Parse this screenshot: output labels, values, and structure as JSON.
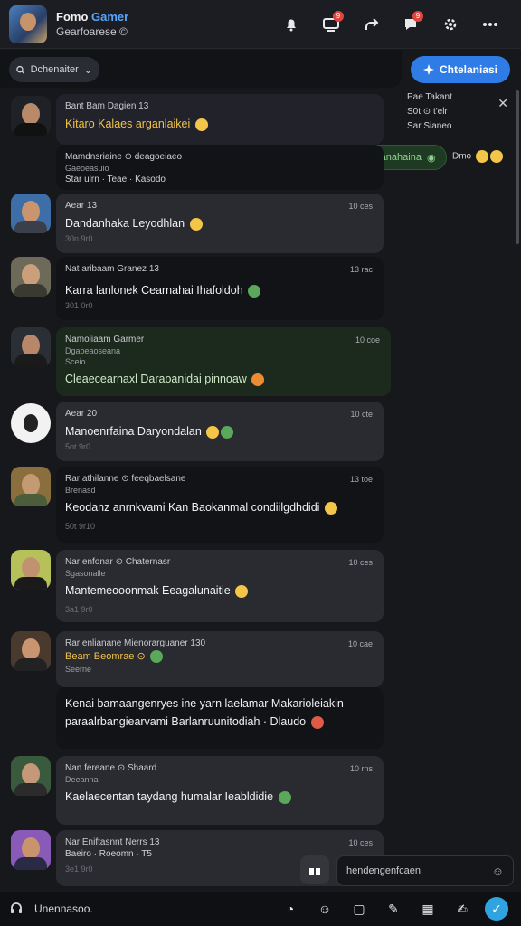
{
  "header": {
    "title_main": "Fomo",
    "title_accent": "Gamer",
    "subtitle": "Gearfoarese ©",
    "badges": [
      "9",
      "9"
    ]
  },
  "filter": {
    "label": "Dchenaiter",
    "chevron": "⌄"
  },
  "cta": {
    "label": "Chtelaniasi"
  },
  "sidepanel": {
    "line1": "Pae Takant",
    "line2": "S0t ⊙ t'elr",
    "line3": "Sar Sianeo"
  },
  "chips": {
    "green": "Abar Danahaina",
    "second": "Dmo"
  },
  "messages": [
    {
      "name": "Bant Bam Dagien 13",
      "sub": "",
      "text": "Kitaro Kalaes arganlaikei",
      "text2_line1": "Mamdnsriaine ⊙ deagoeiaeo",
      "text2_line2": "Gaeoeasuio",
      "text2_line3": "Star ulrn  ·  Teae  ·  Kasodo",
      "time": "",
      "meta": ""
    },
    {
      "name": "Aear 13",
      "sub": "",
      "text": "Dandanhaka Leyodhlan",
      "time": "10 ces",
      "meta": "30n 9r0"
    },
    {
      "name": "Nat aribaam Granez 13",
      "sub": "",
      "text": "Karra lanlonek Cearnahai Ihafoldoh",
      "time": "13 rac",
      "meta": "301 0r0"
    },
    {
      "name": "Namoliaam Garmer",
      "sub": "Dgaoeaoseana",
      "sub2": "Sceio",
      "text": "Cleaecearnaxl Daraoanidai  pinnoaw",
      "time": "10 coe",
      "meta": ""
    },
    {
      "name": "Aear 20",
      "sub": "",
      "text": "Manoenrfaina Daryondalan",
      "time": "10 cte",
      "meta": "5ot 9r0"
    },
    {
      "name": "Rar athilanne ⊙ feeqbaelsane",
      "sub": "Brenasd",
      "text": "Keodanz anrnkvami Kan Baokanmal condiilgdhdidi",
      "time": "13 toe",
      "meta": "50t 9r10"
    },
    {
      "name": "Nar enfonar ⊙ Chaternasr",
      "sub": "Sgasonalle",
      "text": "Mantemeooonmak Eeagalunaitie",
      "time": "10 ces",
      "meta": "3a1 9r0"
    },
    {
      "name": "Rar enlianane Mienorarguaner 130",
      "sub": "Beam Beomrae ⊙",
      "sub2": "Seerne",
      "text": "Kenai bamaangenryes ine yarn laelamar Makarioleiakin",
      "text_line2": "paraalrbangiearvami Barlanruunitodiah  ·  Dlaudo",
      "time": "10 cae",
      "meta": ""
    },
    {
      "name": "Nan fereane ⊙ Shaard",
      "sub": "Deeanna",
      "text": "Kaelaecentan taydang humalar  Ieabldidie",
      "time": "10 rns",
      "meta": ""
    },
    {
      "name": "Nar Eniftasnnt Nerrs 13",
      "sub": "Baeiro · Roeomn · T5",
      "text": "",
      "time": "10 ces",
      "meta": "3e1 9r0"
    }
  ],
  "composer": {
    "placeholder": "hendengenfcaen."
  },
  "bottombar": {
    "label": "Unennasoo."
  },
  "colors": {
    "accent": "#2f7ce6",
    "green_bubble": "#1c2a1e",
    "badge": "#e0443c"
  }
}
